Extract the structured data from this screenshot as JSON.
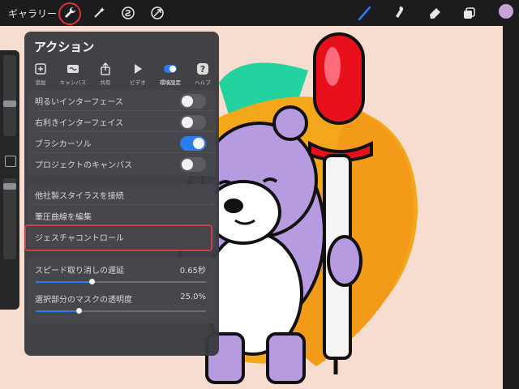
{
  "toolbar": {
    "gallery_label": "ギャラリー",
    "left_icons": [
      "wrench-icon",
      "magic-wand-icon",
      "selection-icon",
      "transform-arrow-icon"
    ],
    "right_icons": [
      "brush-icon",
      "smudge-icon",
      "eraser-icon",
      "layers-icon"
    ],
    "color_swatch": "#c7a3d7"
  },
  "panel": {
    "title": "アクション",
    "tabs": [
      {
        "label": "追加",
        "icon": "add-icon"
      },
      {
        "label": "キャンバス",
        "icon": "canvas-icon"
      },
      {
        "label": "共有",
        "icon": "share-icon"
      },
      {
        "label": "ビデオ",
        "icon": "play-icon"
      },
      {
        "label": "環境設定",
        "icon": "toggle-icon"
      },
      {
        "label": "ヘルプ",
        "icon": "help-icon"
      }
    ],
    "active_tab": "環境設定",
    "toggles": [
      {
        "label": "明るいインターフェース",
        "on": false
      },
      {
        "label": "右利きインターフェイス",
        "on": false
      },
      {
        "label": "ブラシカーソル",
        "on": true
      },
      {
        "label": "プロジェクトのキャンバス",
        "on": false
      }
    ],
    "links": [
      {
        "label": "他社製スタイラスを接続"
      },
      {
        "label": "筆圧曲線を編集"
      },
      {
        "label": "ジェスチャコントロール"
      }
    ],
    "sliders": [
      {
        "label": "スピード取り消しの遅延",
        "value": "0.65秒",
        "fraction": 0.33
      },
      {
        "label": "選択部分のマスクの透明度",
        "value": "25.0%",
        "fraction": 0.25
      }
    ]
  },
  "colors": {
    "accent": "#2a7cf2",
    "annotation": "#e0303a"
  }
}
